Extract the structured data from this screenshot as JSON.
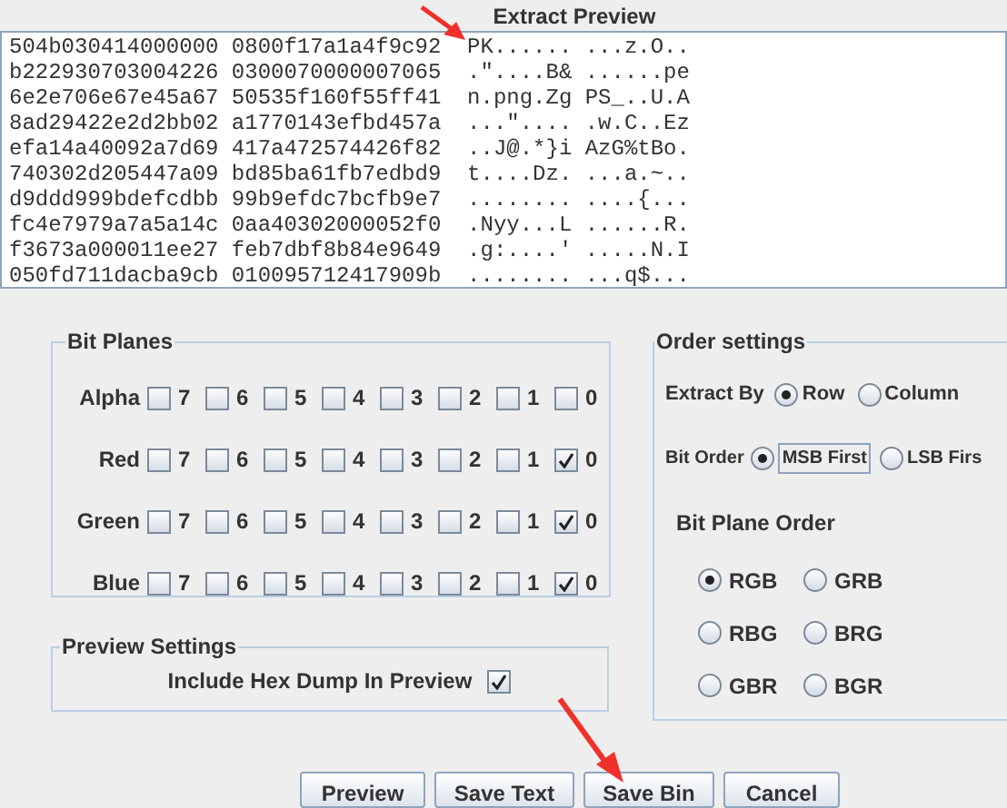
{
  "window": {
    "title": "Extract Preview"
  },
  "preview": {
    "lines": [
      "504b030414000000 0800f17a1a4f9c92  PK...... ...z.O..",
      "b222930703004226 0300070000007065  .\"....B& ......pe",
      "6e2e706e67e45a67 50535f160f55ff41  n.png.Zg PS_..U.A",
      "8ad29422e2d2bb02 a1770143efbd457a  ...\".... .w.C..Ez",
      "efa14a40092a7d69 417a472574426f82  ..J@.*}i AzG%tBo.",
      "740302d205447a09 bd85ba61fb7edbd9  t....Dz. ...a.~..",
      "d9ddd999bdefcdbb 99b9efdc7bcfb9e7  ........ ....{...",
      "fc4e7979a7a5a14c 0aa40302000052f0  .Nyy...L ......R.",
      "f3673a000011ee27 feb7dbf8b84e9649  .g:....' .....N.I",
      "050fd711dacba9cb 010095712417909b  ........ ...q$..."
    ]
  },
  "bit_planes": {
    "title": "Bit Planes",
    "channels": [
      {
        "name": "Alpha",
        "bits": [
          {
            "label": "7",
            "checked": false
          },
          {
            "label": "6",
            "checked": false
          },
          {
            "label": "5",
            "checked": false
          },
          {
            "label": "4",
            "checked": false
          },
          {
            "label": "3",
            "checked": false
          },
          {
            "label": "2",
            "checked": false
          },
          {
            "label": "1",
            "checked": false
          },
          {
            "label": "0",
            "checked": false
          }
        ]
      },
      {
        "name": "Red",
        "bits": [
          {
            "label": "7",
            "checked": false
          },
          {
            "label": "6",
            "checked": false
          },
          {
            "label": "5",
            "checked": false
          },
          {
            "label": "4",
            "checked": false
          },
          {
            "label": "3",
            "checked": false
          },
          {
            "label": "2",
            "checked": false
          },
          {
            "label": "1",
            "checked": false
          },
          {
            "label": "0",
            "checked": true
          }
        ]
      },
      {
        "name": "Green",
        "bits": [
          {
            "label": "7",
            "checked": false
          },
          {
            "label": "6",
            "checked": false
          },
          {
            "label": "5",
            "checked": false
          },
          {
            "label": "4",
            "checked": false
          },
          {
            "label": "3",
            "checked": false
          },
          {
            "label": "2",
            "checked": false
          },
          {
            "label": "1",
            "checked": false
          },
          {
            "label": "0",
            "checked": true
          }
        ]
      },
      {
        "name": "Blue",
        "bits": [
          {
            "label": "7",
            "checked": false
          },
          {
            "label": "6",
            "checked": false
          },
          {
            "label": "5",
            "checked": false
          },
          {
            "label": "4",
            "checked": false
          },
          {
            "label": "3",
            "checked": false
          },
          {
            "label": "2",
            "checked": false
          },
          {
            "label": "1",
            "checked": false
          },
          {
            "label": "0",
            "checked": true
          }
        ]
      }
    ]
  },
  "preview_settings": {
    "title": "Preview Settings",
    "include_hex_dump": {
      "label": "Include Hex Dump In Preview",
      "checked": true
    }
  },
  "order_settings": {
    "title": "Order settings",
    "extract_by": {
      "label": "Extract By",
      "options": [
        {
          "label": "Row",
          "selected": true
        },
        {
          "label": "Column",
          "selected": false
        }
      ]
    },
    "bit_order": {
      "label": "Bit Order",
      "options": [
        {
          "label": "MSB First",
          "selected": true
        },
        {
          "label": "LSB Firs",
          "selected": false
        }
      ]
    },
    "bit_plane_order": {
      "label": "Bit Plane Order",
      "options": [
        {
          "label": "RGB",
          "selected": true
        },
        {
          "label": "GRB",
          "selected": false
        },
        {
          "label": "RBG",
          "selected": false
        },
        {
          "label": "BRG",
          "selected": false
        },
        {
          "label": "GBR",
          "selected": false
        },
        {
          "label": "BGR",
          "selected": false
        }
      ]
    }
  },
  "buttons": [
    "Preview",
    "Save Text",
    "Save Bin",
    "Cancel"
  ]
}
